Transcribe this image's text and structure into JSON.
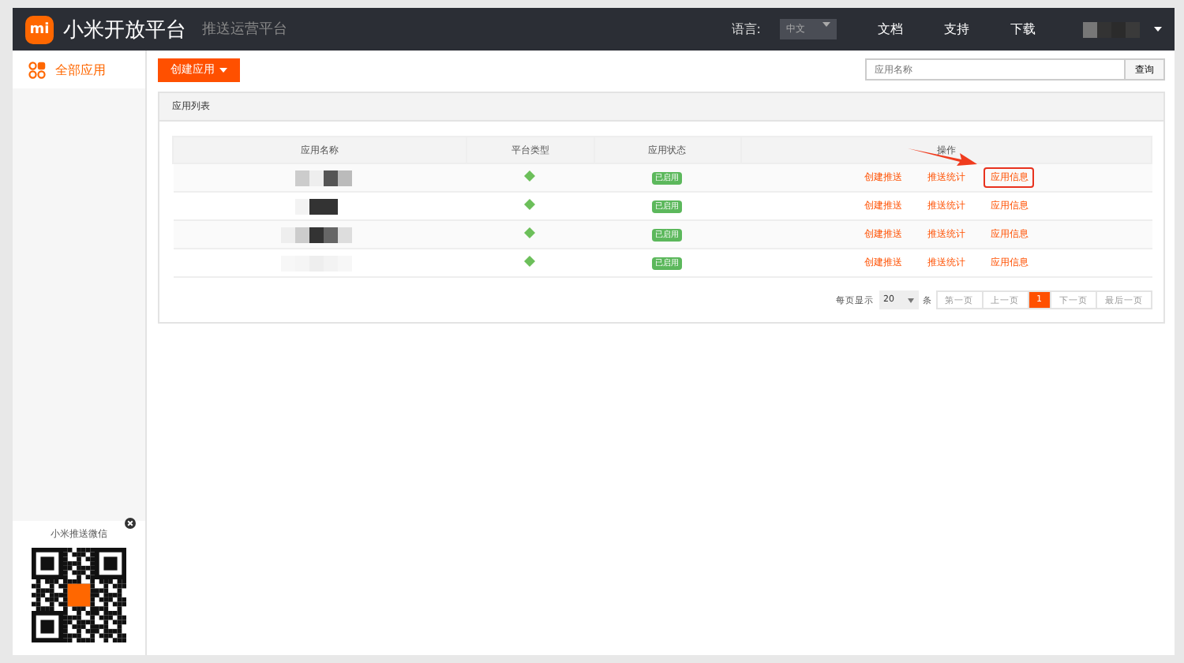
{
  "header": {
    "logo": "mi",
    "title": "小米开放平台",
    "subtitle": "推送运营平台",
    "language_label": "语言:",
    "language": "中文",
    "nav": [
      "文档",
      "支持",
      "下载"
    ]
  },
  "sidebar": {
    "items": [
      {
        "label": "全部应用",
        "selected": true
      }
    ],
    "qr_title": "小米推送微信"
  },
  "toolbar": {
    "create_button": "创建应用",
    "search": {
      "placeholder": "应用名称"
    },
    "search_button": "查询"
  },
  "panel": {
    "title": "应用列表",
    "table": {
      "columns": [
        "应用名称",
        "平台类型",
        "应用状态",
        "操作"
      ],
      "rows": [
        {
          "status": "已启用",
          "actions": [
            {
              "label": "创建推送",
              "highlighted": false
            },
            {
              "label": "推送统计",
              "highlighted": false
            },
            {
              "label": "应用信息",
              "highlighted": true
            }
          ]
        },
        {
          "status": "已启用",
          "actions": [
            {
              "label": "创建推送",
              "highlighted": false
            },
            {
              "label": "推送统计",
              "highlighted": false
            },
            {
              "label": "应用信息",
              "highlighted": false
            }
          ]
        },
        {
          "status": "已启用",
          "actions": [
            {
              "label": "创建推送",
              "highlighted": false
            },
            {
              "label": "推送统计",
              "highlighted": false
            },
            {
              "label": "应用信息",
              "highlighted": false
            }
          ]
        },
        {
          "status": "已启用",
          "actions": [
            {
              "label": "创建推送",
              "highlighted": false
            },
            {
              "label": "推送统计",
              "highlighted": false
            },
            {
              "label": "应用信息",
              "highlighted": false
            }
          ]
        }
      ]
    },
    "pagination": {
      "per_page_label": "每页显示",
      "per_page": "20",
      "unit": "条",
      "first": "第一页",
      "prev": "上一页",
      "pages": [
        {
          "label": "1",
          "selected": true
        }
      ],
      "next": "下一页",
      "last": "最后一页"
    }
  }
}
